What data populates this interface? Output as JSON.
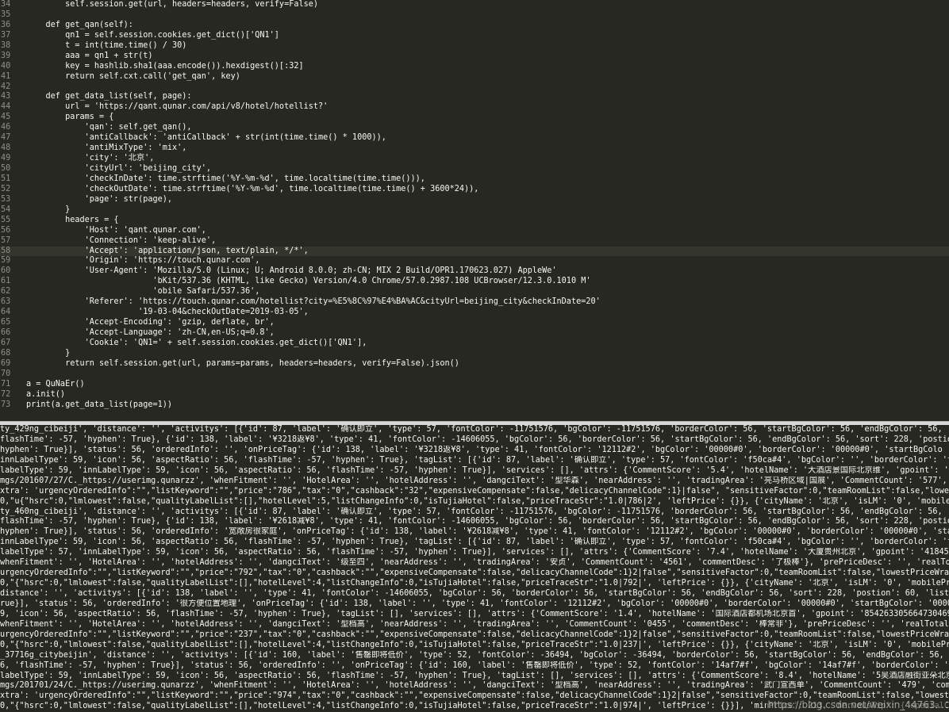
{
  "editor": {
    "highlighted_line": "58",
    "lines": [
      {
        "num": "34",
        "text": "        self.session.get(url, headers=headers, verify=False)"
      },
      {
        "num": "35",
        "text": ""
      },
      {
        "num": "36",
        "text": "    def get_qan(self):"
      },
      {
        "num": "37",
        "text": "        qn1 = self.session.cookies.get_dict()['QN1']"
      },
      {
        "num": "38",
        "text": "        t = int(time.time() / 30)"
      },
      {
        "num": "39",
        "text": "        aaa = qn1 + str(t)"
      },
      {
        "num": "40",
        "text": "        key = hashlib.sha1(aaa.encode()).hexdigest()[:32]"
      },
      {
        "num": "41",
        "text": "        return self.cxt.call('get_qan', key)"
      },
      {
        "num": "42",
        "text": ""
      },
      {
        "num": "43",
        "text": "    def get_data_list(self, page):"
      },
      {
        "num": "44",
        "text": "        url = 'https://qant.qunar.com/api/v8/hotel/hotellist?'"
      },
      {
        "num": "45",
        "text": "        params = {"
      },
      {
        "num": "46",
        "text": "            'qan': self.get_qan(),"
      },
      {
        "num": "47",
        "text": "            'antiCallback': 'antiCallback' + str(int(time.time() * 1000)),"
      },
      {
        "num": "48",
        "text": "            'antiMixType': 'mix',"
      },
      {
        "num": "49",
        "text": "            'city': '北京',"
      },
      {
        "num": "50",
        "text": "            'cityUrl': 'beijing_city',"
      },
      {
        "num": "51",
        "text": "            'checkInDate': time.strftime('%Y-%m-%d', time.localtime(time.time())),"
      },
      {
        "num": "52",
        "text": "            'checkOutDate': time.strftime('%Y-%m-%d', time.localtime(time.time() + 3600*24)),"
      },
      {
        "num": "53",
        "text": "            'page': str(page),"
      },
      {
        "num": "54",
        "text": "        }"
      },
      {
        "num": "55",
        "text": "        headers = {"
      },
      {
        "num": "56",
        "text": "            'Host': 'qant.qunar.com',"
      },
      {
        "num": "57",
        "text": "            'Connection': 'keep-alive',"
      },
      {
        "num": "58",
        "text": "            'Accept': 'application/json, text/plain, */*',"
      },
      {
        "num": "59",
        "text": "            'Origin': 'https://touch.qunar.com',"
      },
      {
        "num": "60",
        "text": "            'User-Agent': 'Mozilla/5.0 (Linux; U; Android 8.0.0; zh-CN; MIX 2 Build/OPR1.170623.027) AppleWe'"
      },
      {
        "num": "61",
        "text": "                          'bKit/537.36 (KHTML, like Gecko) Version/4.0 Chrome/57.0.2987.108 UCBrowser/12.3.0.1010 M'"
      },
      {
        "num": "62",
        "text": "                          'obile Safari/537.36',"
      },
      {
        "num": "63",
        "text": "            'Referer': 'https://touch.qunar.com/hotellist?city=%E5%8C%97%E4%BA%AC&cityUrl=beijing_city&checkInDate=20'"
      },
      {
        "num": "64",
        "text": "                       '19-03-04&checkOutDate=2019-03-05',"
      },
      {
        "num": "65",
        "text": "            'Accept-Encoding': 'gzip, deflate, br',"
      },
      {
        "num": "66",
        "text": "            'Accept-Language': 'zh-CN,en-US;q=0.8',"
      },
      {
        "num": "67",
        "text": "            'Cookie': 'QN1=' + self.session.cookies.get_dict()['QN1'],"
      },
      {
        "num": "68",
        "text": "        }"
      },
      {
        "num": "69",
        "text": "        return self.session.get(url, params=params, headers=headers, verify=False).json()"
      },
      {
        "num": "70",
        "text": ""
      },
      {
        "num": "71",
        "text": "a = QuNaEr()"
      },
      {
        "num": "72",
        "text": "a.init()"
      },
      {
        "num": "73",
        "text": "print(a.get_data_list(page=1))"
      }
    ]
  },
  "console": {
    "lines": [
      "ty_429ng_cibeiji', 'distance': '', 'activitys': [{'id': 87, 'label': '确认即立', 'type': 57, 'fontColor': -11751576, 'bgColor': -11751576, 'borderColor': 56, 'startBgColor': 56, 'endBgColor': 56, 'so",
      "flashTime': -57, 'hyphen': True}, {'id': 138, 'label': '¥3218返¥8', 'type': 41, 'fontColor': -14606055, 'bgColor': 56, 'borderColor': 56, 'startBgColor': 56, 'endBgColor': 56, 'sort': 228, 'postion'",
      "hyphen': True}], 'status': 56, 'orderedInfo': '', 'onPriceTag': {'id': 138, 'label': '¥3218返¥8', 'type': 41, 'fontColor': '12112#2', 'bgColor': '00000#0', 'borderColor': '00000#0', 'startBgColo",
      "innLabelType': 59, 'icon': 56, 'aspectRatio': 56, 'flashTime': -57, 'hyphen': True}, 'tagList': [{'id': 87, 'label': '确认即立', 'type': 57, 'fontColor': 'f50ca#4', 'bgColor': '', 'borderColor': 'f50",
      "labelType': 59, 'innLabelType': 59, 'icon': 56, 'aspectRatio': 56, 'flashTime': -57, 'hyphen': True}], 'services': [], 'attrs': {'CommentScore': '5.4', 'hotelName': '大酒店景国际北京维', 'gpoint': '14",
      "mgs/201607/27/C._https://userimg.qunarzz', 'whenFitment': '', 'HotelArea': '', 'hotelAddress': '', 'dangciText': '型华森', 'nearAddress': '', 'tradingArea': '亮马桥区域|国展', 'CommentCount': '577', '",
      "xtra': 'urgencyOrderedInfo\":\"\",\"listKeyword\":\"\",\"price\":\"786\",\"tax\":\"0\",\"cashback\":\"32\",\"expensiveCompensate\":false,\"delicacyChannelCode\":1}|false\", \"sensitiveFactor\":0,\"teamRoomList\":false,\"lowestPr",
      "0,\"u{\"hsrc\":0,\"lmlowest\":false,\"qualityLabelList\":[],\"hotelLevel\":5,\"listChangeInfo\":0,\"isTujiaHotel\":false,\"priceTraceStr\":\"1.0|786|2', 'leftPrice': {}}, {'cityName': '北京', 'isLM': '0', 'mobilePr",
      "ty_460ng_cibeiji', 'distance': '', 'activitys': [{'id': 87, 'label': '确认即立', 'type': 57, 'fontColor': -11751576, 'bgColor': -11751576, 'borderColor': 56, 'startBgColor': 56, 'endBgColor': 56, 'so",
      "flashTime': -57, 'hyphen': True}, {'id': 138, 'label': '¥2618减¥8', 'type': 41, 'fontColor': -14606055, 'bgColor': 56, 'borderColor': 56, 'startBgColor': 56, 'endBgColor': 56, 'sort': 228, 'postion'",
      "hyphen': True}], 'status': 56, 'orderedInfo': '宽敞房很家庭', 'onPriceTag': {'id': 138, 'label': '¥2618减¥8', 'type': 41, 'fontColor': '12112#2', 'bgColor': '00000#0', 'borderColor': '00000#0', 'start",
      "innLabelType': 59, 'icon': 56, 'aspectRatio': 56, 'flashTime': -57, 'hyphen': True}, 'tagList': [{'id': 87, 'label': '确认即立', 'type': 57, 'fontColor': 'f50ca#4', 'bgColor': '', 'borderColor': 'f5",
      "labelType': 57, 'innLabelType': 59, 'icon': 56, 'aspectRatio': 56, 'flashTime': -57, 'hyphen': True}], 'services': [], 'attrs': {'CommentScore': '7.4', 'hotelName': '大厦贵州北京', 'gpoint': '4184570",
      "whenFitment': '', 'HotelArea': '', 'hotelAddress': '', 'dangciText': '级至四', 'nearAddress': '', 'tradingArea': '安贞', 'CommentCount': '4561', 'commentDesc': '了极棒'}, 'prePriceDesc': '', 'realTota",
      "urgencyOrderedInfo\":\"\",\"listKeyword\":\"\",\"price\":\"792\",\"tax\":\"0\",\"cashback\":\"\",\"expensiveCompensate\":false,\"delicacyChannelCode\":1}2|false\",\"sensitiveFactor\":0,\"teamRoomList\":false,\"lowestPriceWrappe",
      "0,\"{\"hsrc\":0,\"lmlowest\":false,\"qualityLabelList\":[],\"hotelLevel\":4,\"listChangeInfo\":0,\"isTujiaHotel\":false,\"priceTraceStr\":\"1.0|792|', 'leftPrice': {}}, {'cityName': '北京', 'isLM': '0', 'mobilePri",
      "distance': '', 'activitys': [{'id': 138, 'label': '', 'type': 41, 'fontColor': -14606055, 'bgColor': 56, 'borderColor': 56, 'startBgColor': 56, 'endBgColor': 56, 'sort': 228, 'postion': 60, 'listPri",
      "rue}], 'status': 56, 'orderedInfo': '很方便位置地理', 'onPriceTag': {'id': 138, 'label': '', 'type': 41, 'fontColor': '12112#2', 'bgColor': '00000#0', 'borderColor': '00000#0', 'startBgColor': '00000#0",
      "9, 'icon': 56, 'aspectRatio': 56, 'flashTime': -57, 'hyphen': True}, 'tagList': [], 'services': [], 'attrs': {'CommentScore': '1.4', 'hotelName': '国际酒店都机场北京首', 'gpoint': '854263305664730469,",
      "whenFitment': '', 'HotelArea': '', 'hotelAddress': '', 'dangciText': '型档高', 'nearAddress': '', 'tradingArea': '', 'CommentCount': '0455', 'commentDesc': '棒常非'}, 'prePriceDesc': '', 'realTotalPri",
      "urgencyOrderedInfo\":\"\",\"listKeyword\":\"\",\"price\":\"237\",\"tax\":\"0\",\"cashback\":\"\",\"expensiveCompensate\":false,\"delicacyChannelCode\":1}2|false\",\"sensitiveFactor\":0,\"teamRoomList\":false,\"lowestPriceWrappe",
      "0,\"{\"hsrc\":0,\"lmlowest\":false,\"qualityLabelList\":[],\"hotelLevel\":4,\"listChangeInfo\":0,\"isTujiaHotel\":false,\"priceTraceStr\":\"1.0|237|', 'leftPrice': {}}, {'cityName': '北京', 'isLM': '0', 'mobilePri",
      "_37716g_citybeijin', 'distance': '', 'activitys': [{'id': 160, 'label': '售罄即将低价', 'type': 52, 'fontColor': -36494, 'bgColor': -36494, 'borderColor': 56, 'startBgColor': 56, 'endBgColor': 56, 'so",
      "6, 'flashTime': -57, 'hyphen': True}], 'status': 56, 'orderedInfo': '', 'onPriceTag': {'id': 160, 'label': '售罄即将低价', 'type': 52, 'fontColor': '14af7#f', 'bgColor': '14af7#f', 'borderColor': '14af7",
      "labelType': 59, 'innLabelType': 59, 'icon': 56, 'aspectRatio': 56, 'flashTime': -57, 'hyphen': True}, 'tagList': [], 'services': [], 'attrs': {'CommentScore': '8.4', 'hotelName': '5吴酒店融街亚朵北京金",
      "mgs/201701/24/C._https://userimg.qunarzz', 'whenFitment': '', 'HotelArea': '', 'hotelAddress': '', 'dangciText': '型档高', 'nearAddress': '', 'tradingArea': '武门宣西单', 'CommentCount': '479', 'comm",
      "xtra': 'urgencyOrderedInfo\":\"\",\"listKeyword\":\"\",\"price\":\"974\",\"tax\":\"0\",\"cashback\":\"\",\"expensiveCompensate\":false,\"delicacyChannelCode\":1}2|false\",\"sensitiveFactor\":0,\"teamRoomList\":false,\"lowestPri",
      "0,\"{\"hsrc\":0,\"lmlowest\":false,\"qualityLabelList\":[],\"hotelLevel\":4,\"listChangeInfo\":0,\"isTujiaHotel\":false,\"priceTraceStr\":\"1.0|974|', 'leftPrice': {}}], 'minPrice': 213, 'nervousTip': {'specialCo"
    ]
  },
  "watermark": "https://blog.csdn.net/weixin_44763..."
}
